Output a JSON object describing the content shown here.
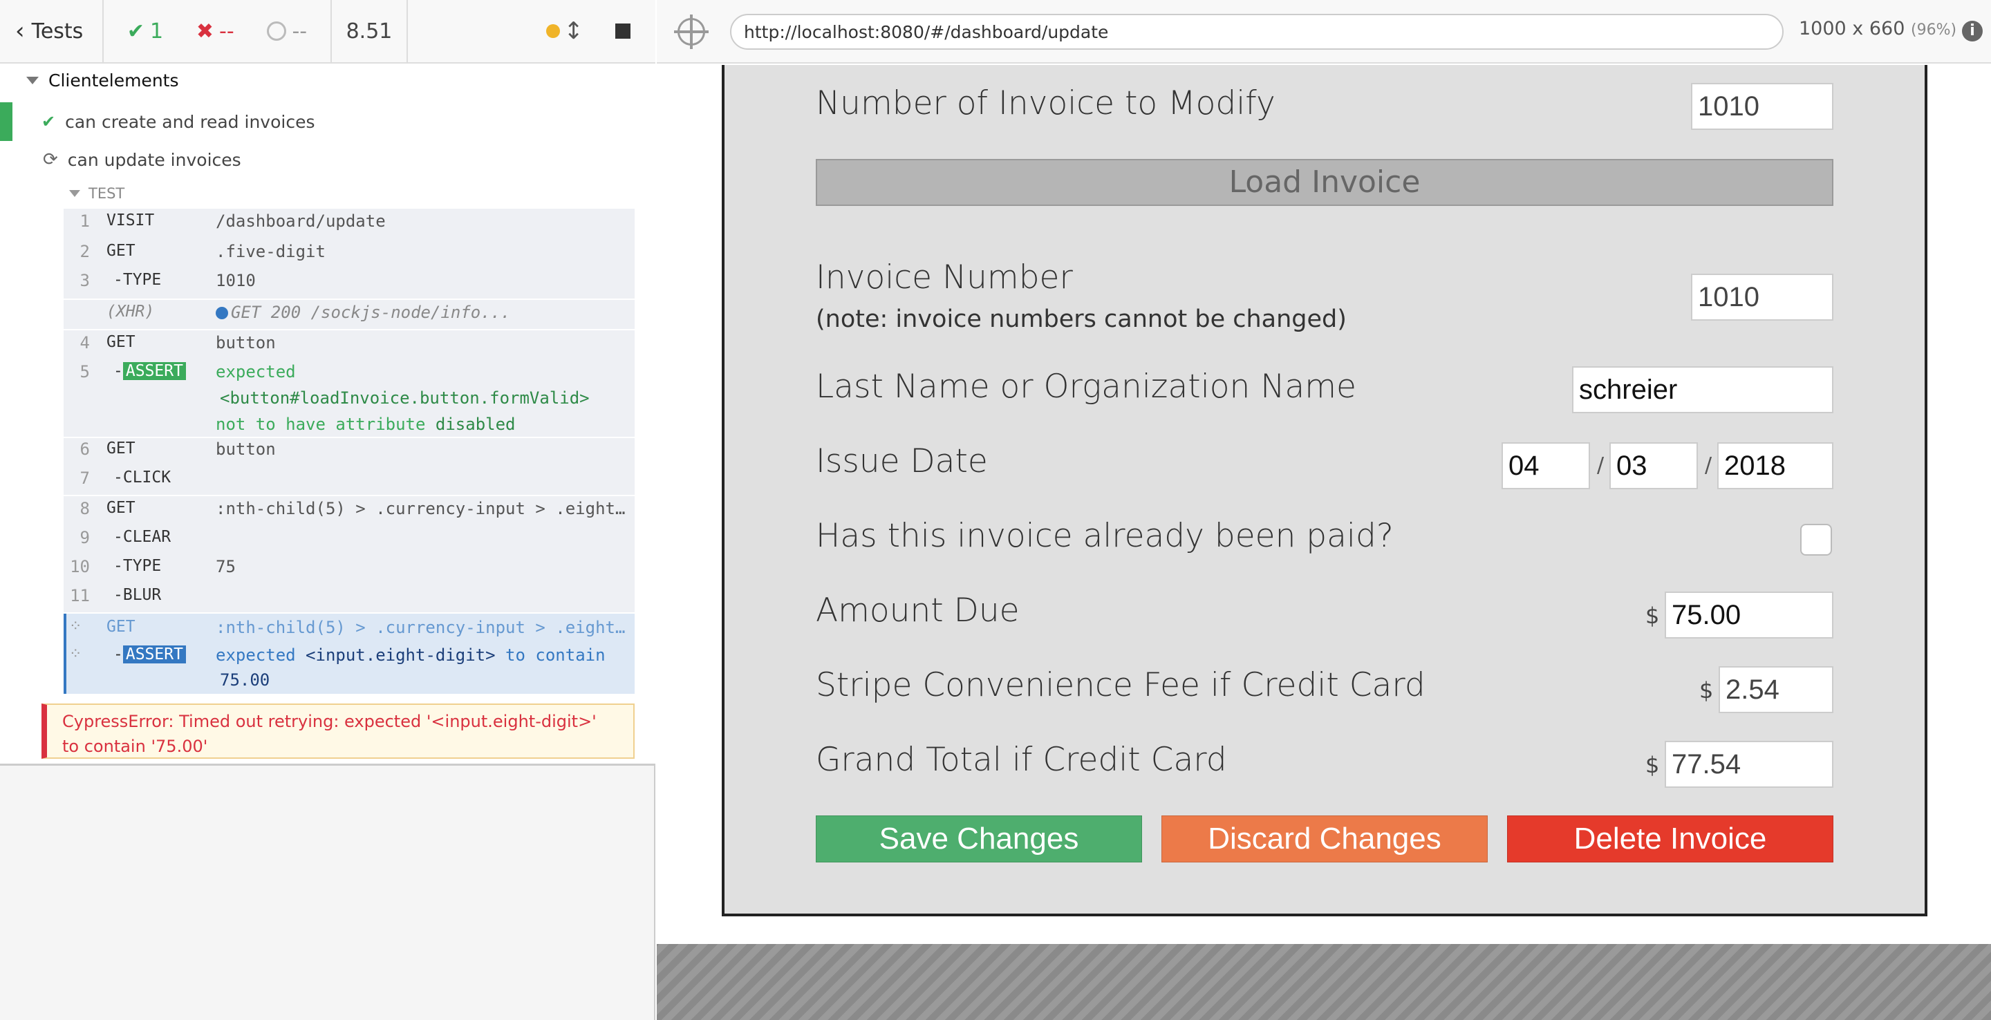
{
  "reporter": {
    "tests_label": "Tests",
    "passed": "1",
    "failed": "--",
    "pending": "--",
    "duration": "8.51",
    "suite_title": "Clientelements",
    "tests": [
      {
        "title": "can create and read invoices",
        "state": "passed"
      },
      {
        "title": "can update invoices",
        "state": "running"
      }
    ],
    "hook_label": "TEST",
    "commands": [
      {
        "num": "1",
        "name": "VISIT",
        "msg": "/dashboard/update"
      },
      {
        "num": "2",
        "name": "GET",
        "msg": ".five-digit"
      },
      {
        "num": "3",
        "name": "-TYPE",
        "msg": "1010"
      },
      {
        "num": "",
        "name": "(XHR)",
        "msg": "GET 200 /sockjs-node/info..."
      },
      {
        "num": "4",
        "name": "GET",
        "msg": "button"
      },
      {
        "num": "5",
        "name": "ASSERT",
        "msg_1": "expected",
        "msg_2": "<button#loadInvoice.button.formValid>",
        "msg_3a": "not to have attribute",
        "msg_3b": "disabled"
      },
      {
        "num": "6",
        "name": "GET",
        "msg": "button"
      },
      {
        "num": "7",
        "name": "-CLICK",
        "msg": ""
      },
      {
        "num": "8",
        "name": "GET",
        "msg": ":nth-child(5) > .currency-input > .eight…"
      },
      {
        "num": "9",
        "name": "-CLEAR",
        "msg": ""
      },
      {
        "num": "10",
        "name": "-TYPE",
        "msg": "75"
      },
      {
        "num": "11",
        "name": "-BLUR",
        "msg": ""
      },
      {
        "num": "",
        "name": "GET",
        "msg": ":nth-child(5) > .currency-input > .eight…"
      },
      {
        "num": "",
        "name": "ASSERT",
        "msg_1": "expected",
        "msg_2": "<input.eight-digit>",
        "msg_3": "to contain",
        "msg_4": "75.00"
      }
    ],
    "error_line1": "CypressError: Timed out retrying: expected '<input.eight-digit>'",
    "error_line2": "to contain '75.00'"
  },
  "aut_header": {
    "url": "http://localhost:8080/#/dashboard/update",
    "viewport": "1000 x 660",
    "zoom": "(96%)",
    "info_icon": "i"
  },
  "form": {
    "modify_label": "Number of Invoice to Modify",
    "modify_value": "1010",
    "load_button": "Load Invoice",
    "invoice_number_label": "Invoice Number",
    "invoice_number_note": "(note: invoice numbers cannot be changed)",
    "invoice_number_value": "1010",
    "name_label": "Last Name or Organization Name",
    "name_value": "schreier",
    "issue_date_label": "Issue Date",
    "date_month": "04",
    "date_day": "03",
    "date_year": "2018",
    "date_sep": "/",
    "paid_label": "Has this invoice already been paid?",
    "amount_label": "Amount Due",
    "amount_value": "75.00",
    "fee_label": "Stripe Convenience Fee if Credit Card",
    "fee_value": "2.54",
    "total_label": "Grand Total if Credit Card",
    "total_value": "77.54",
    "currency": "$",
    "save_button": "Save Changes",
    "discard_button": "Discard Changes",
    "delete_button": "Delete Invoice"
  }
}
